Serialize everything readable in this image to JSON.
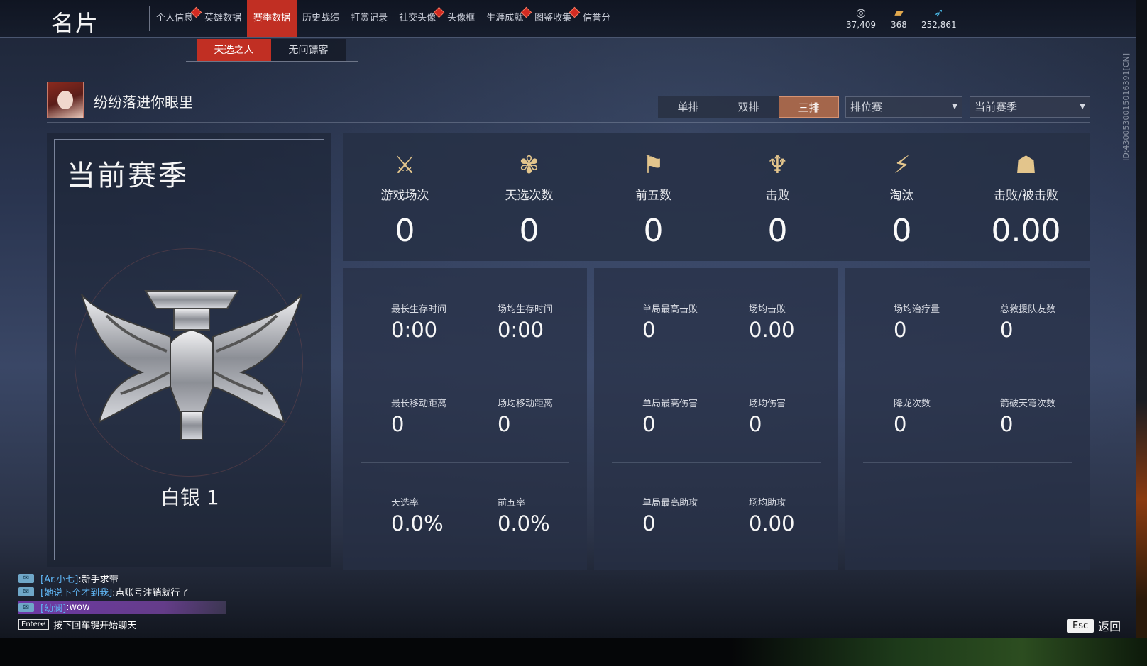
{
  "header": {
    "title": "名片",
    "nav": [
      {
        "label": "个人信息",
        "badge": true
      },
      {
        "label": "英雄数据",
        "badge": false
      },
      {
        "label": "赛季数据",
        "badge": false,
        "active": true
      },
      {
        "label": "历史战绩",
        "badge": false
      },
      {
        "label": "打赏记录",
        "badge": false
      },
      {
        "label": "社交头像",
        "badge": true
      },
      {
        "label": "头像框",
        "badge": false
      },
      {
        "label": "生涯成就",
        "badge": true
      },
      {
        "label": "图鉴收集",
        "badge": true
      },
      {
        "label": "信誉分",
        "badge": false
      }
    ],
    "currencies": [
      {
        "icon": "coin-icon",
        "value": "37,409"
      },
      {
        "icon": "ticket-icon",
        "value": "368"
      },
      {
        "icon": "feather-icon",
        "value": "252,861"
      }
    ]
  },
  "subtabs": [
    "天选之人",
    "无间镖客"
  ],
  "player": {
    "name": "纷纷落进你眼里"
  },
  "modes": [
    "单排",
    "双排",
    "三排"
  ],
  "active_mode": "三排",
  "filters": {
    "match_type": "排位赛",
    "season": "当前赛季"
  },
  "season_card": {
    "title": "当前赛季",
    "rank": "白银 1"
  },
  "top_stats": [
    {
      "icon": "crossed-swords-icon",
      "label": "游戏场次",
      "value": "0"
    },
    {
      "icon": "lotus-icon",
      "label": "天选次数",
      "value": "0"
    },
    {
      "icon": "banner-icon",
      "label": "前五数",
      "value": "0"
    },
    {
      "icon": "trident-icon",
      "label": "击败",
      "value": "0"
    },
    {
      "icon": "broken-blade-icon",
      "label": "淘汰",
      "value": "0"
    },
    {
      "icon": "mask-icon",
      "label": "击败/被击败",
      "value": "0.00"
    }
  ],
  "panels": [
    [
      {
        "label": "最长生存时间",
        "value": "0:00"
      },
      {
        "label": "场均生存时间",
        "value": "0:00"
      },
      {
        "label": "最长移动距离",
        "value": "0"
      },
      {
        "label": "场均移动距离",
        "value": "0"
      },
      {
        "label": "天选率",
        "value": "0.0%"
      },
      {
        "label": "前五率",
        "value": "0.0%"
      }
    ],
    [
      {
        "label": "单局最高击败",
        "value": "0"
      },
      {
        "label": "场均击败",
        "value": "0.00"
      },
      {
        "label": "单局最高伤害",
        "value": "0"
      },
      {
        "label": "场均伤害",
        "value": "0"
      },
      {
        "label": "单局最高助攻",
        "value": "0"
      },
      {
        "label": "场均助攻",
        "value": "0.00"
      }
    ],
    [
      {
        "label": "场均治疗量",
        "value": "0"
      },
      {
        "label": "总救援队友数",
        "value": "0"
      },
      {
        "label": "降龙次数",
        "value": "0"
      },
      {
        "label": "箭破天穹次数",
        "value": "0"
      }
    ]
  ],
  "chat": [
    {
      "name": "[Ar.小七]",
      "text": ":新手求带"
    },
    {
      "name": "[她说下个才到我]",
      "text": ":点账号注销就行了"
    },
    {
      "name": "[幼澜]",
      "text": ":wow"
    }
  ],
  "chat_hint": {
    "key": "Enter↵",
    "text": "按下回车键开始聊天"
  },
  "esc": {
    "key": "Esc",
    "label": "返回"
  },
  "side_id": "ID:4300530015016391[CN]"
}
